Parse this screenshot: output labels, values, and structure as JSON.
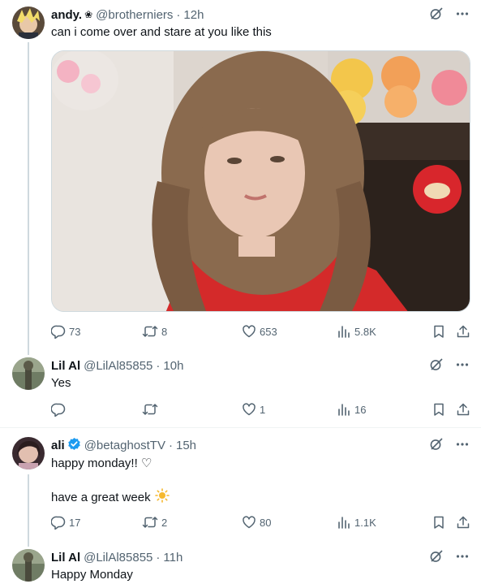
{
  "tweets": [
    {
      "name": "andy.",
      "name_suffix": "❀",
      "handle": "@brotherniers",
      "separator": "·",
      "time": "12h",
      "text": "can i come over and stare at you like this",
      "replies": "73",
      "reposts": "8",
      "likes": "653",
      "views": "5.8K"
    },
    {
      "name": "Lil Al",
      "handle": "@LilAl85855",
      "separator": "·",
      "time": "10h",
      "text": "Yes",
      "replies": "",
      "reposts": "",
      "likes": "1",
      "views": "16"
    },
    {
      "name": "ali",
      "handle": "@betaghostTV",
      "separator": "·",
      "time": "15h",
      "text_line1": "happy monday!! ♡",
      "text_line2": "have a great week",
      "replies": "17",
      "reposts": "2",
      "likes": "80",
      "views": "1.1K"
    },
    {
      "name": "Lil Al",
      "handle": "@LilAl85855",
      "separator": "·",
      "time": "11h",
      "text": "Happy Monday"
    }
  ],
  "icons": {
    "reply": "reply-icon",
    "repost": "repost-icon",
    "like": "heart-icon",
    "views": "views-icon",
    "bookmark": "bookmark-icon",
    "share": "share-icon",
    "grok": "grok-icon",
    "more": "more-icon",
    "verified": "verified-badge-icon",
    "sun": "sun-emoji"
  },
  "colors": {
    "text": "#0f1419",
    "secondary": "#536471",
    "verified": "#1d9bf0",
    "thread_line": "#cfd9de",
    "divider": "#eff3f4"
  }
}
